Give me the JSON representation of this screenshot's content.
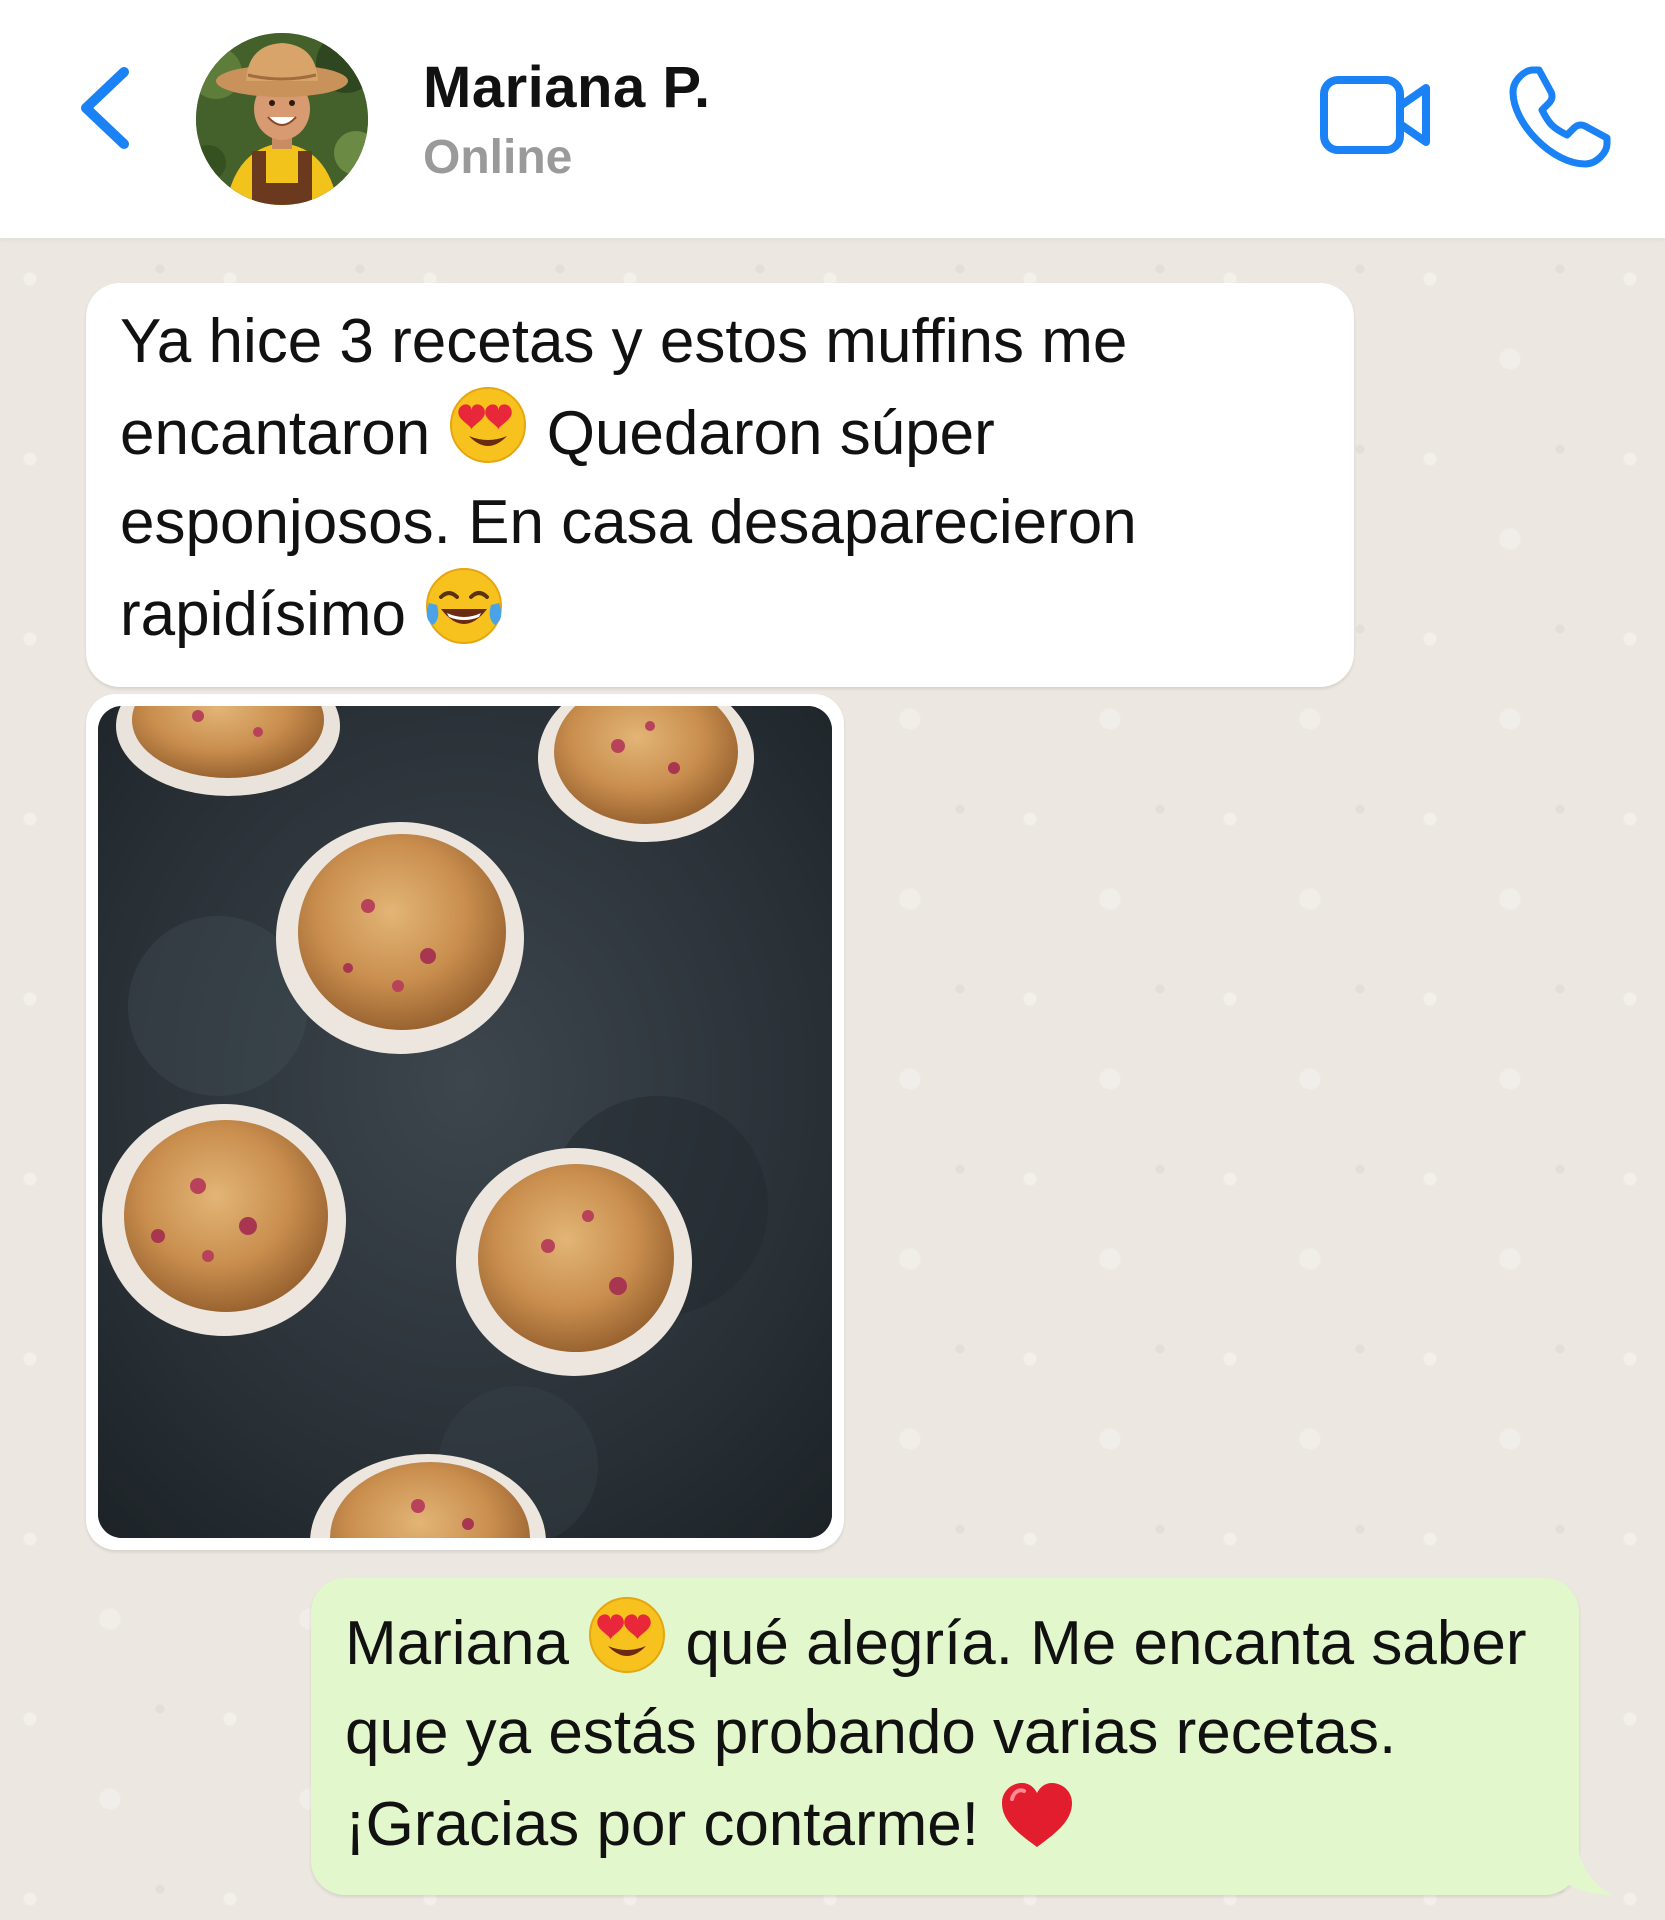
{
  "header": {
    "contact_name": "Mariana P.",
    "status": "Online",
    "icons": {
      "back": "chevron-left-icon",
      "video": "video-camera-icon",
      "call": "phone-icon"
    },
    "accent_color": "#1a82f5"
  },
  "messages": [
    {
      "direction": "incoming",
      "type": "text",
      "parts": {
        "a": "Ya hice 3 recetas y estos muffins me encantaron",
        "emoji_1": "heart-eyes-emoji",
        "b": "Quedaron súper esponjosos. En casa desaparecieron rapidísimo",
        "emoji_2": "tears-of-joy-emoji"
      }
    },
    {
      "direction": "incoming",
      "type": "image",
      "image_subject": "muffins on dark stone surface"
    },
    {
      "direction": "outgoing",
      "type": "text",
      "parts": {
        "a": "Mariana",
        "emoji_1": "heart-eyes-emoji",
        "b": "qué alegría. Me encanta saber que ya estás probando varias recetas. ¡Gracias por contarme!",
        "emoji_2": "red-heart-emoji"
      }
    }
  ],
  "colors": {
    "incoming_bubble": "#ffffff",
    "outgoing_bubble": "#e2f7cb",
    "chat_background": "#ece8e1"
  }
}
